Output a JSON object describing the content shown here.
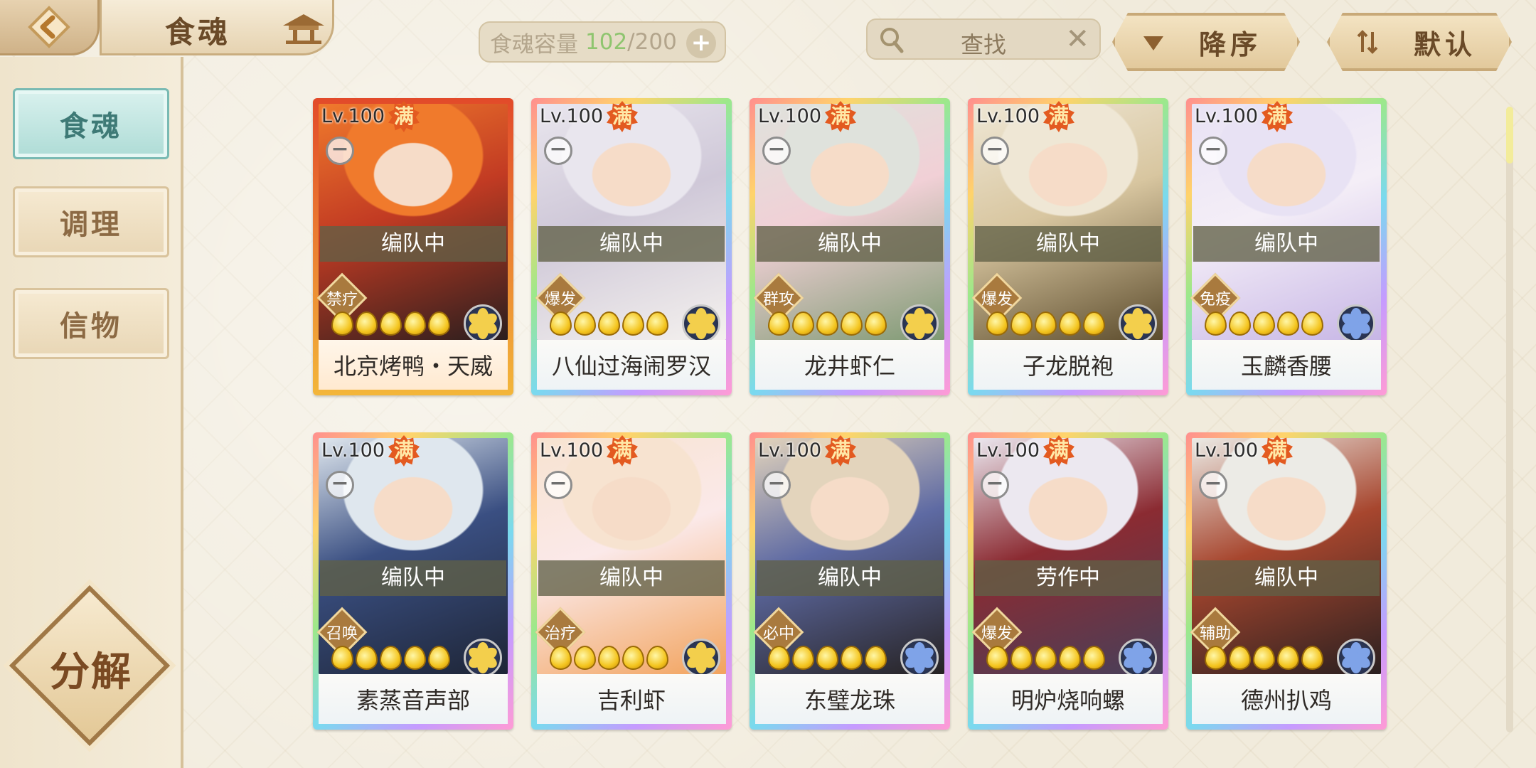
{
  "header": {
    "title": "食魂",
    "capacity": {
      "label": "食魂容量",
      "current": "102",
      "sep": "/",
      "max": "200",
      "plus": "+"
    },
    "search": {
      "placeholder": "查找",
      "clear": "✕"
    },
    "sort_order": "降序",
    "sort_mode": "默认"
  },
  "sidebar": {
    "items": [
      {
        "label": "食魂",
        "active": true
      },
      {
        "label": "调理",
        "active": false
      },
      {
        "label": "信物",
        "active": false
      }
    ],
    "decompose": "分解"
  },
  "cards": [
    {
      "level": "Lv.100",
      "max_badge": "满",
      "status": "编队中",
      "role": "禁疗",
      "name": "北京烤鸭・天威",
      "stars": 5,
      "theme": "red",
      "element": "gold",
      "art": [
        "#f07a2c",
        "#2a1e1e",
        "#c23b23"
      ]
    },
    {
      "level": "Lv.100",
      "max_badge": "满",
      "status": "编队中",
      "role": "爆发",
      "name": "八仙过海闹罗汉",
      "stars": 5,
      "theme": "rainbow",
      "element": "gold",
      "art": [
        "#e9e6ee",
        "#f4f1ee",
        "#cfc8d8"
      ]
    },
    {
      "level": "Lv.100",
      "max_badge": "满",
      "status": "编队中",
      "role": "群攻",
      "name": "龙井虾仁",
      "stars": 5,
      "theme": "rainbow",
      "element": "gold",
      "art": [
        "#dfe2dc",
        "#7e9a73",
        "#f1d0d6"
      ]
    },
    {
      "level": "Lv.100",
      "max_badge": "满",
      "status": "编队中",
      "role": "爆发",
      "name": "子龙脱袍",
      "stars": 5,
      "theme": "rainbow",
      "element": "gold",
      "art": [
        "#efe7d5",
        "#5b4b2c",
        "#d8c6a0"
      ]
    },
    {
      "level": "Lv.100",
      "max_badge": "满",
      "status": "编队中",
      "role": "免疫",
      "name": "玉麟香腰",
      "stars": 5,
      "theme": "rainbow",
      "element": "blue",
      "art": [
        "#e8e2f4",
        "#c7b6e6",
        "#f4eef7"
      ]
    },
    {
      "level": "Lv.100",
      "max_badge": "满",
      "status": "编队中",
      "role": "召唤",
      "name": "素蒸音声部",
      "stars": 5,
      "theme": "rainbow",
      "element": "gold",
      "art": [
        "#dfe7ee",
        "#1e2536",
        "#3a4f82"
      ]
    },
    {
      "level": "Lv.100",
      "max_badge": "满",
      "status": "编队中",
      "role": "治疗",
      "name": "吉利虾",
      "stars": 5,
      "theme": "rainbow",
      "element": "gold",
      "art": [
        "#f7e3d0",
        "#f2a35d",
        "#fbe9e9"
      ]
    },
    {
      "level": "Lv.100",
      "max_badge": "满",
      "status": "编队中",
      "role": "必中",
      "name": "东璧龙珠",
      "stars": 5,
      "theme": "rainbow",
      "element": "blue",
      "art": [
        "#e3d4bc",
        "#262222",
        "#5e6aa3"
      ]
    },
    {
      "level": "Lv.100",
      "max_badge": "满",
      "status": "劳作中",
      "role": "爆发",
      "name": "明炉烧响螺",
      "stars": 5,
      "theme": "rainbow",
      "element": "blue",
      "art": [
        "#ece8f0",
        "#47405a",
        "#8b2b32"
      ]
    },
    {
      "level": "Lv.100",
      "max_badge": "满",
      "status": "编队中",
      "role": "辅助",
      "name": "德州扒鸡",
      "stars": 5,
      "theme": "rainbow",
      "element": "blue",
      "art": [
        "#ecebe6",
        "#2a2020",
        "#a7462e"
      ]
    }
  ],
  "colors": {
    "accent_teal": "#aedcd6",
    "max_badge": "#e35a20",
    "capacity_current": "#8fc56f"
  },
  "icons": [
    "back-arrow-icon",
    "pavilion-icon",
    "search-icon",
    "clear-icon",
    "plus-icon",
    "sort-down-icon",
    "sort-swap-icon",
    "minus-icon",
    "star-icon",
    "element-flower-icon"
  ]
}
